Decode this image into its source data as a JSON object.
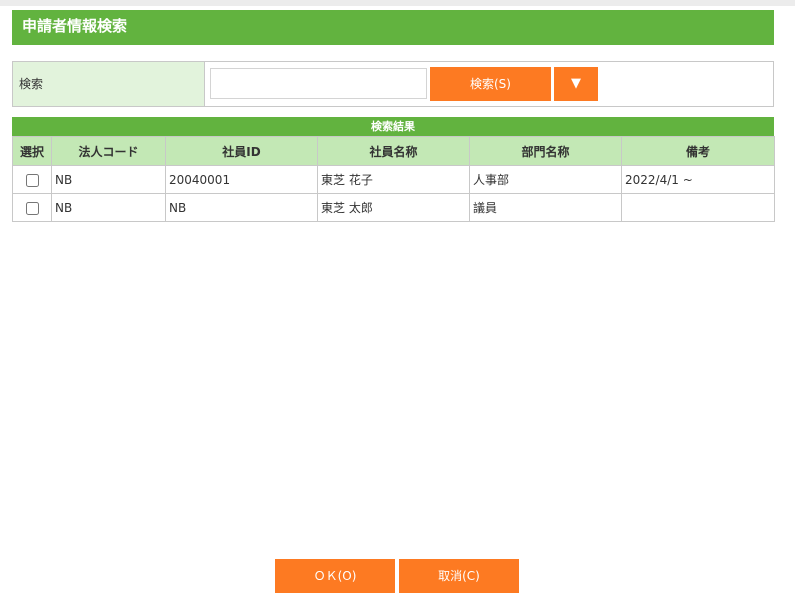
{
  "title": "申請者情報検索",
  "search": {
    "label": "検索",
    "value": "",
    "button": "検索(S)",
    "dropdown": "▼"
  },
  "results": {
    "heading": "検索結果",
    "columns": [
      "選択",
      "法人コード",
      "社員ID",
      "社員名称",
      "部門名称",
      "備考"
    ],
    "rows": [
      {
        "checked": false,
        "corp": "NB",
        "id": "20040001",
        "name": "東芝 花子",
        "dept": "人事部",
        "note": "2022/4/1 ~"
      },
      {
        "checked": false,
        "corp": "NB",
        "id": "NB",
        "name": "東芝 太郎",
        "dept": "議員",
        "note": ""
      }
    ]
  },
  "footer": {
    "ok": "ＯＫ(O)",
    "cancel": "取消(C)"
  }
}
